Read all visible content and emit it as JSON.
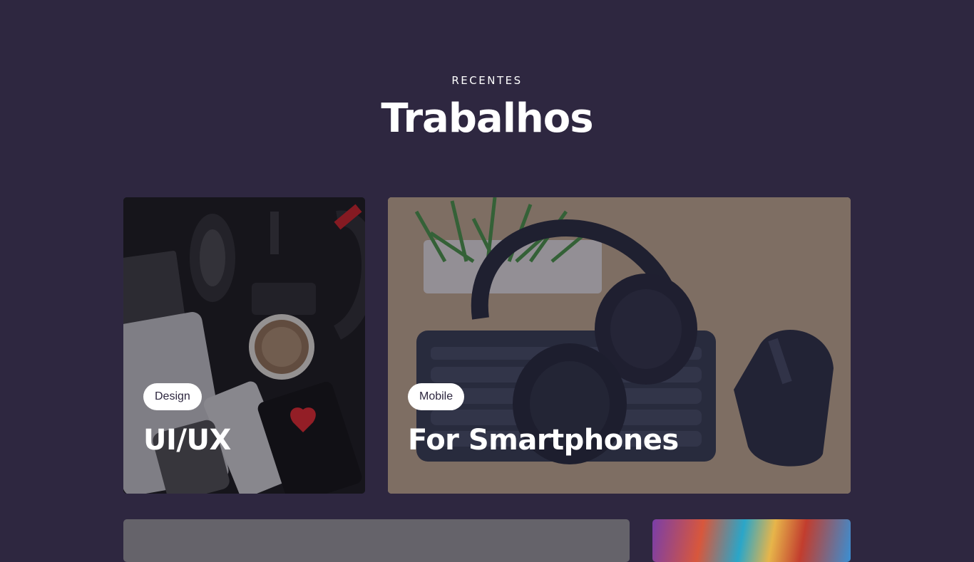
{
  "section": {
    "eyebrow": "RECENTES",
    "title": "Trabalhos"
  },
  "cards": [
    {
      "tag": "Design",
      "title": "UI/UX"
    },
    {
      "tag": "Mobile",
      "title": "For Smartphones"
    }
  ],
  "colors": {
    "background": "#2e2740",
    "badge_bg": "#ffffff",
    "badge_text": "#2e2740"
  }
}
